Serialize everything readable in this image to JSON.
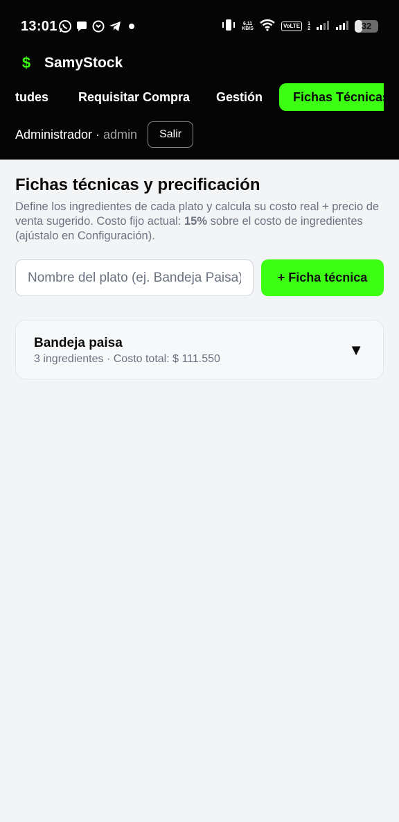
{
  "status_bar": {
    "time": "13:01",
    "net_speed_value": "6,11",
    "net_speed_unit": "KB/S",
    "volte": "VoLTE",
    "sim_1": "1",
    "sim_2": "2",
    "battery": "32",
    "battery_level": 0.32,
    "notification_icons": [
      "whatsapp-icon",
      "chat-bubble-icon",
      "sync-chat-icon",
      "telegram-icon",
      "dot-icon"
    ],
    "system_icons": [
      "vibrate-icon",
      "wifi-icon",
      "signal-icon",
      "signal-icon"
    ]
  },
  "brand": {
    "logo": "$",
    "name": "SamyStock"
  },
  "tabs": [
    {
      "label": "tudes",
      "active": false
    },
    {
      "label": "Requisitar Compra",
      "active": false
    },
    {
      "label": "Gestión",
      "active": false
    },
    {
      "label": "Fichas Técnicas",
      "active": true
    }
  ],
  "user": {
    "role": "Administrador ·",
    "username": "admin",
    "logout_label": "Salir"
  },
  "page": {
    "title": "Fichas técnicas y precificación",
    "description_1": "Define los ingredientes de cada plato y calcula su costo real + precio de venta sugerido. Costo fijo actual: ",
    "fixed_cost": "15%",
    "description_2": " sobre el costo de ingredientes (ajústalo en Configuración)."
  },
  "form": {
    "dish_placeholder": "Nombre del plato (ej. Bandeja Paisa)",
    "add_label": "+ Ficha técnica"
  },
  "dishes": [
    {
      "name": "Bandeja paisa",
      "summary": "3 ingredientes · Costo total: $ 111.550",
      "toggle": "▼"
    }
  ],
  "colors": {
    "accent": "#3cff14",
    "header_bg": "#050505",
    "page_bg": "#f3f4f6"
  }
}
